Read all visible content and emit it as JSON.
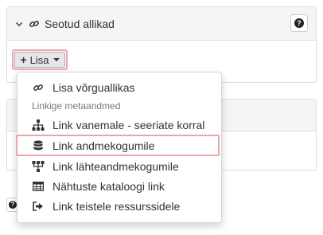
{
  "panel_main": {
    "title": "Seotud allikad",
    "help_symbol": "?",
    "add_button_label": "Lisa"
  },
  "dropdown": {
    "items": [
      {
        "label": "Lisa võrguallikas",
        "icon": "link-icon"
      },
      {
        "label": "Linkige metaandmed",
        "type": "header"
      },
      {
        "label": "Link vanemale - seeriate korral",
        "icon": "sitemap-icon"
      },
      {
        "label": "Link andmekogumile",
        "icon": "database-icon",
        "selected": true
      },
      {
        "label": "Link lähteandmekogumile",
        "icon": "source-tree-icon"
      },
      {
        "label": "Nähtuste kataloogi link",
        "icon": "table-icon"
      },
      {
        "label": "Link teistele ressurssidele",
        "icon": "sign-out-icon"
      }
    ]
  },
  "colors": {
    "highlight_border": "#e8a6aa",
    "panel_header_bg": "#f5f5f5",
    "panel_border": "#dddddd"
  }
}
